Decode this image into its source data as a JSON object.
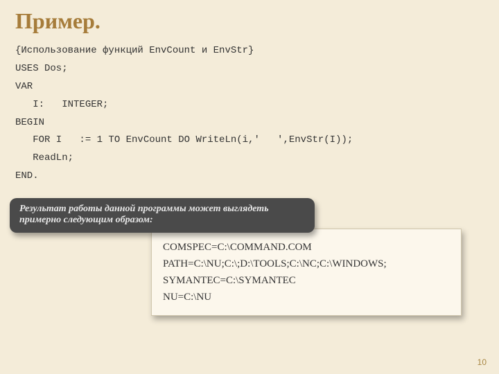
{
  "title": "Пример.",
  "code": {
    "l1": "{Использование функций EnvCount и EnvStr}",
    "l2": "USES Dos;",
    "l3": "VAR",
    "l4": "   I:   INTEGER;",
    "l5": "BEGIN",
    "l6": "   FOR I   := 1 TO EnvCount DO WriteLn(i,'   ',EnvStr(I));",
    "l7": "   ReadLn;",
    "l8": "END."
  },
  "result_caption": "Результат работы данной программы может выглядеть примерно следующим образом:",
  "output": {
    "l1": "COMSPEC=C:\\COMMAND.COM",
    "l2": "PATH=C:\\NU;C:\\;D:\\TOOLS;C:\\NC;C:\\WINDOWS;",
    "l3": "SYMANTEC=C:\\SYMANTEC",
    "l4": "NU=C:\\NU"
  },
  "page_number": "10"
}
